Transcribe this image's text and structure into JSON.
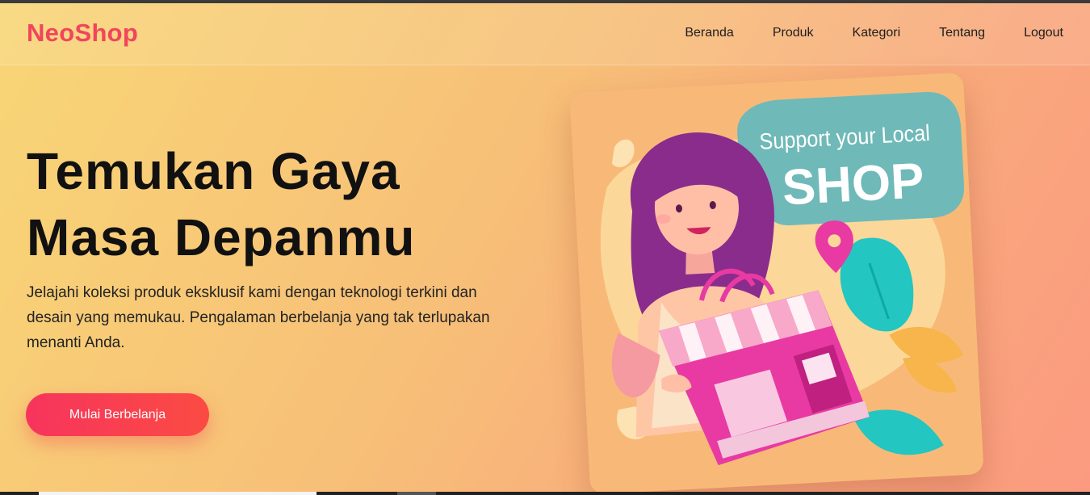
{
  "brand": {
    "name": "NeoShop",
    "color": "#f2445d"
  },
  "nav": {
    "items": [
      {
        "label": "Beranda"
      },
      {
        "label": "Produk"
      },
      {
        "label": "Kategori"
      },
      {
        "label": "Tentang"
      },
      {
        "label": "Logout"
      }
    ]
  },
  "hero": {
    "title_line1": "Temukan Gaya",
    "title_line2": "Masa Depanmu",
    "description": "Jelajahi koleksi produk eksklusif kami dengan teknologi terkini dan desain yang memukau. Pengalaman berbelanja yang tak terlupakan menanti Anda.",
    "cta_label": "Mulai Berbelanja"
  },
  "illustration": {
    "bubble_line1": "Support your Local",
    "bubble_line2": "SHOP",
    "accent_teal": "#6fb9b8",
    "accent_pink": "#e83aa2",
    "hair_purple": "#8a2c8c"
  }
}
